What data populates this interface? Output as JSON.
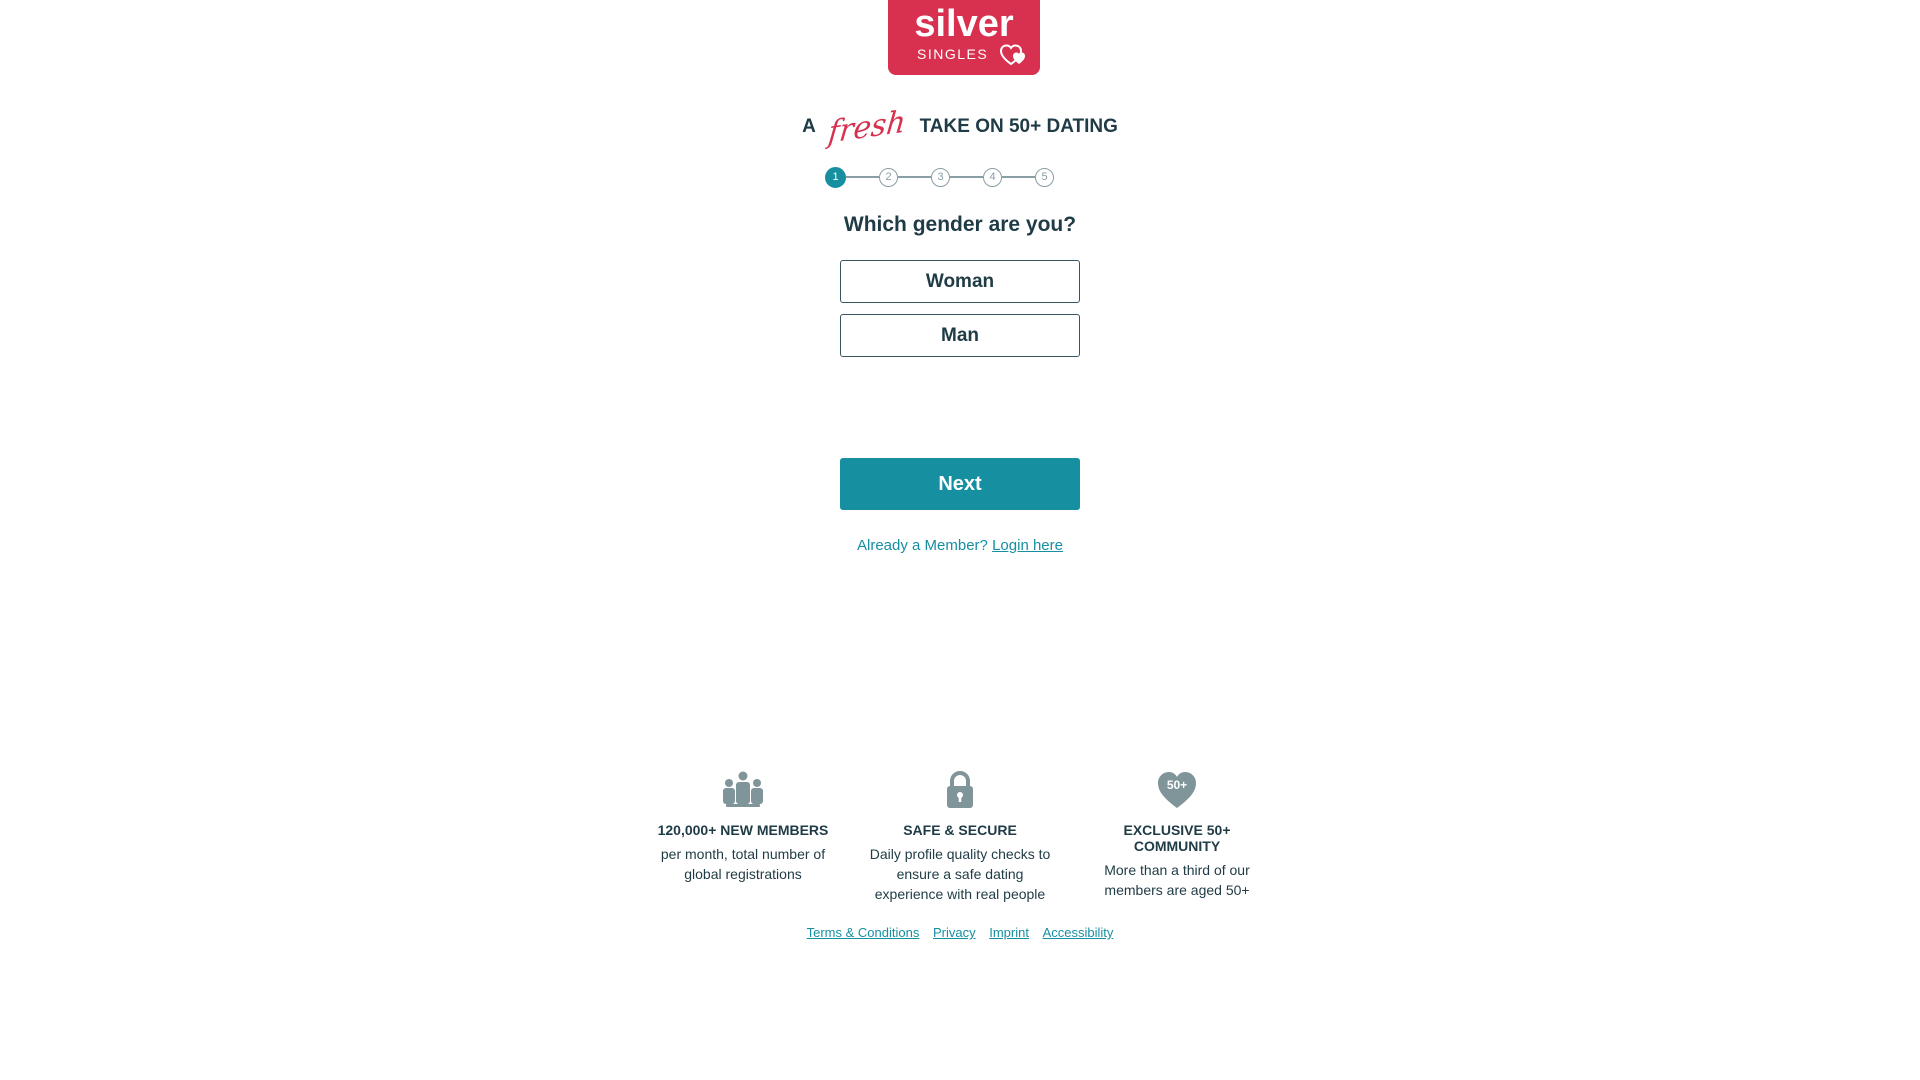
{
  "logo": {
    "main": "silver",
    "sub": "SINGLES"
  },
  "tagline": {
    "prefix": "A",
    "accent": "fresh",
    "suffix": "TAKE ON 50+ DATING"
  },
  "stepper": {
    "current": 1,
    "steps": [
      "1",
      "2",
      "3",
      "4",
      "5"
    ]
  },
  "question": "Which gender are you?",
  "options": {
    "woman": "Woman",
    "man": "Man"
  },
  "next_label": "Next",
  "member": {
    "prompt": "Already a Member?",
    "login_link": "Login here"
  },
  "features": [
    {
      "icon": "people-icon",
      "title": "120,000+ NEW MEMBERS",
      "desc": "per month, total number of global registrations"
    },
    {
      "icon": "lock-icon",
      "title": "SAFE & SECURE",
      "desc": "Daily profile quality checks to ensure a safe dating experience with real people"
    },
    {
      "icon": "heart-50-icon",
      "icon_text": "50+",
      "title": "EXCLUSIVE 50+ COMMUNITY",
      "desc": "More than a third of our members are aged 50+"
    }
  ],
  "footer": {
    "terms": "Terms & Conditions",
    "privacy": "Privacy",
    "imprint": "Imprint",
    "accessibility": "Accessibility"
  },
  "colors": {
    "brand_red": "#d8304f",
    "teal": "#168fa1",
    "text_dark": "#1f3b45",
    "icon_gray": "#7f9599"
  }
}
